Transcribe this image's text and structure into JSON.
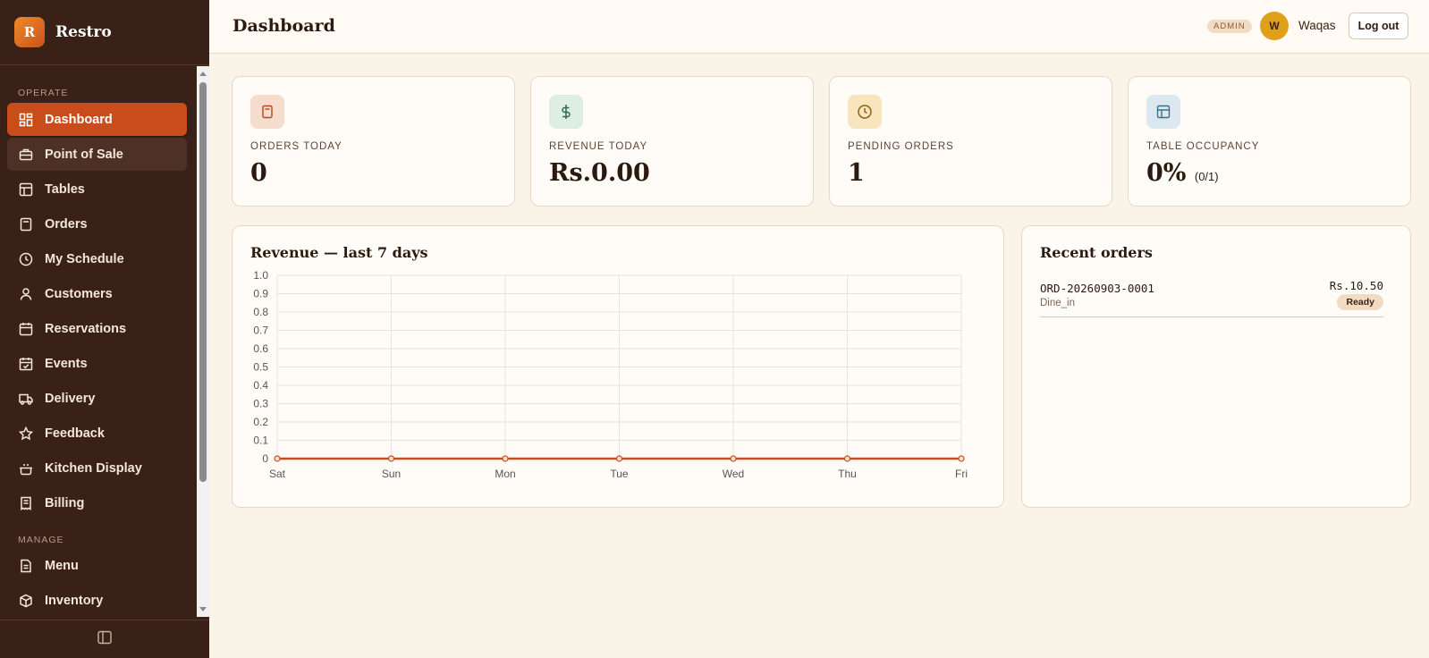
{
  "brand": {
    "logo_letter": "R",
    "name": "Restro"
  },
  "sidebar": {
    "sections": [
      {
        "label": "OPERATE"
      },
      {
        "label": "MANAGE"
      }
    ],
    "items": [
      {
        "label": "Dashboard",
        "icon": "dashboard-grid-icon",
        "state": "active"
      },
      {
        "label": "Point of Sale",
        "icon": "register-icon",
        "state": "hover"
      },
      {
        "label": "Tables",
        "icon": "table-grid-icon"
      },
      {
        "label": "Orders",
        "icon": "receipt-icon"
      },
      {
        "label": "My Schedule",
        "icon": "clock-icon"
      },
      {
        "label": "Customers",
        "icon": "user-icon"
      },
      {
        "label": "Reservations",
        "icon": "calendar-icon"
      },
      {
        "label": "Events",
        "icon": "calendar-check-icon"
      },
      {
        "label": "Delivery",
        "icon": "truck-icon"
      },
      {
        "label": "Feedback",
        "icon": "star-icon"
      },
      {
        "label": "Kitchen Display",
        "icon": "cooking-pot-icon"
      },
      {
        "label": "Billing",
        "icon": "invoice-icon"
      },
      {
        "label": "Menu",
        "icon": "menu-document-icon"
      },
      {
        "label": "Inventory",
        "icon": "package-icon"
      }
    ]
  },
  "header": {
    "title": "Dashboard",
    "role_badge": "ADMIN",
    "avatar_initial": "W",
    "user_name": "Waqas",
    "logout_label": "Log out"
  },
  "stats": [
    {
      "label": "ORDERS TODAY",
      "value": "0",
      "sub": "",
      "icon": "receipt-icon",
      "icon_bg": "#f6dccd",
      "icon_color": "#b9451c"
    },
    {
      "label": "REVENUE TODAY",
      "value": "Rs.0.00",
      "sub": "",
      "icon": "dollar-icon",
      "icon_bg": "#deeee3",
      "icon_color": "#2f6b45"
    },
    {
      "label": "PENDING ORDERS",
      "value": "1",
      "sub": "",
      "icon": "clock-icon",
      "icon_bg": "#f8e5bd",
      "icon_color": "#8a6315"
    },
    {
      "label": "TABLE OCCUPANCY",
      "value": "0%",
      "sub": "(0/1)",
      "icon": "table-grid-icon",
      "icon_bg": "#dce8ef",
      "icon_color": "#3a6f8c"
    }
  ],
  "revenue_panel": {
    "title": "Revenue — last 7 days"
  },
  "chart_data": {
    "type": "line",
    "title": "Revenue — last 7 days",
    "categories": [
      "Sat",
      "Sun",
      "Mon",
      "Tue",
      "Wed",
      "Thu",
      "Fri"
    ],
    "series": [
      {
        "values": [
          0,
          0,
          0,
          0,
          0,
          0,
          0
        ],
        "color": "#c84d1a"
      }
    ],
    "ylim": [
      0,
      1.0
    ],
    "yticks": [
      "0",
      "0.1",
      "0.2",
      "0.3",
      "0.4",
      "0.5",
      "0.6",
      "0.7",
      "0.8",
      "0.9",
      "1.0"
    ],
    "grid": true,
    "xlabel": "",
    "ylabel": ""
  },
  "recent_orders": {
    "title": "Recent orders",
    "items": [
      {
        "order_no": "ORD-20260903-0001",
        "type": "Dine_in",
        "amount": "Rs.10.50",
        "status": "Ready"
      }
    ]
  },
  "colors": {
    "accent": "#c84d1a",
    "sidebar_bg": "#3a2117",
    "page_bg": "#faf3e8"
  }
}
